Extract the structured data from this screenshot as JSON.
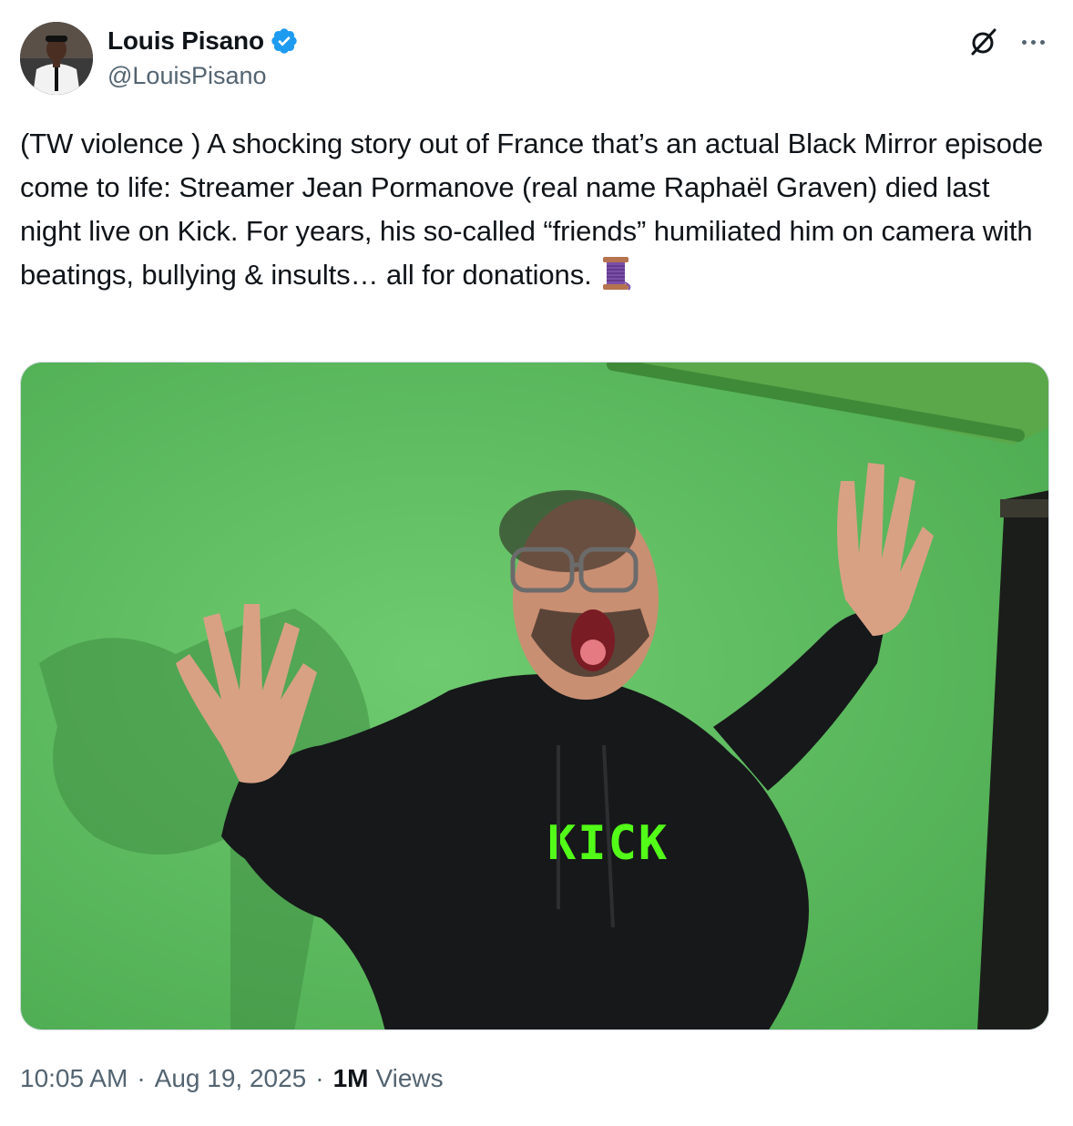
{
  "author": {
    "display_name": "Louis Pisano",
    "handle": "@LouisPisano",
    "verified": true,
    "verified_color": "#1d9bf0"
  },
  "header_icons": {
    "grok": "grok-icon",
    "more": "more-icon"
  },
  "tweet": {
    "text": "(TW violence ) A shocking story out of France that’s an actual Black Mirror episode come to life: Streamer Jean Pormanove (real name Raphaël Graven) died last night live on Kick. For years, his so-called “friends” humiliated him on camera with beatings, bullying & insults… all for donations.",
    "trailing_emoji": "thread-spool-emoji",
    "media": {
      "hoodie_text": "KICK",
      "background_color": "#5fbf63"
    }
  },
  "meta": {
    "time": "10:05 AM",
    "separator": "·",
    "date": "Aug 19, 2025",
    "views_count": "1M",
    "views_label": "Views"
  }
}
